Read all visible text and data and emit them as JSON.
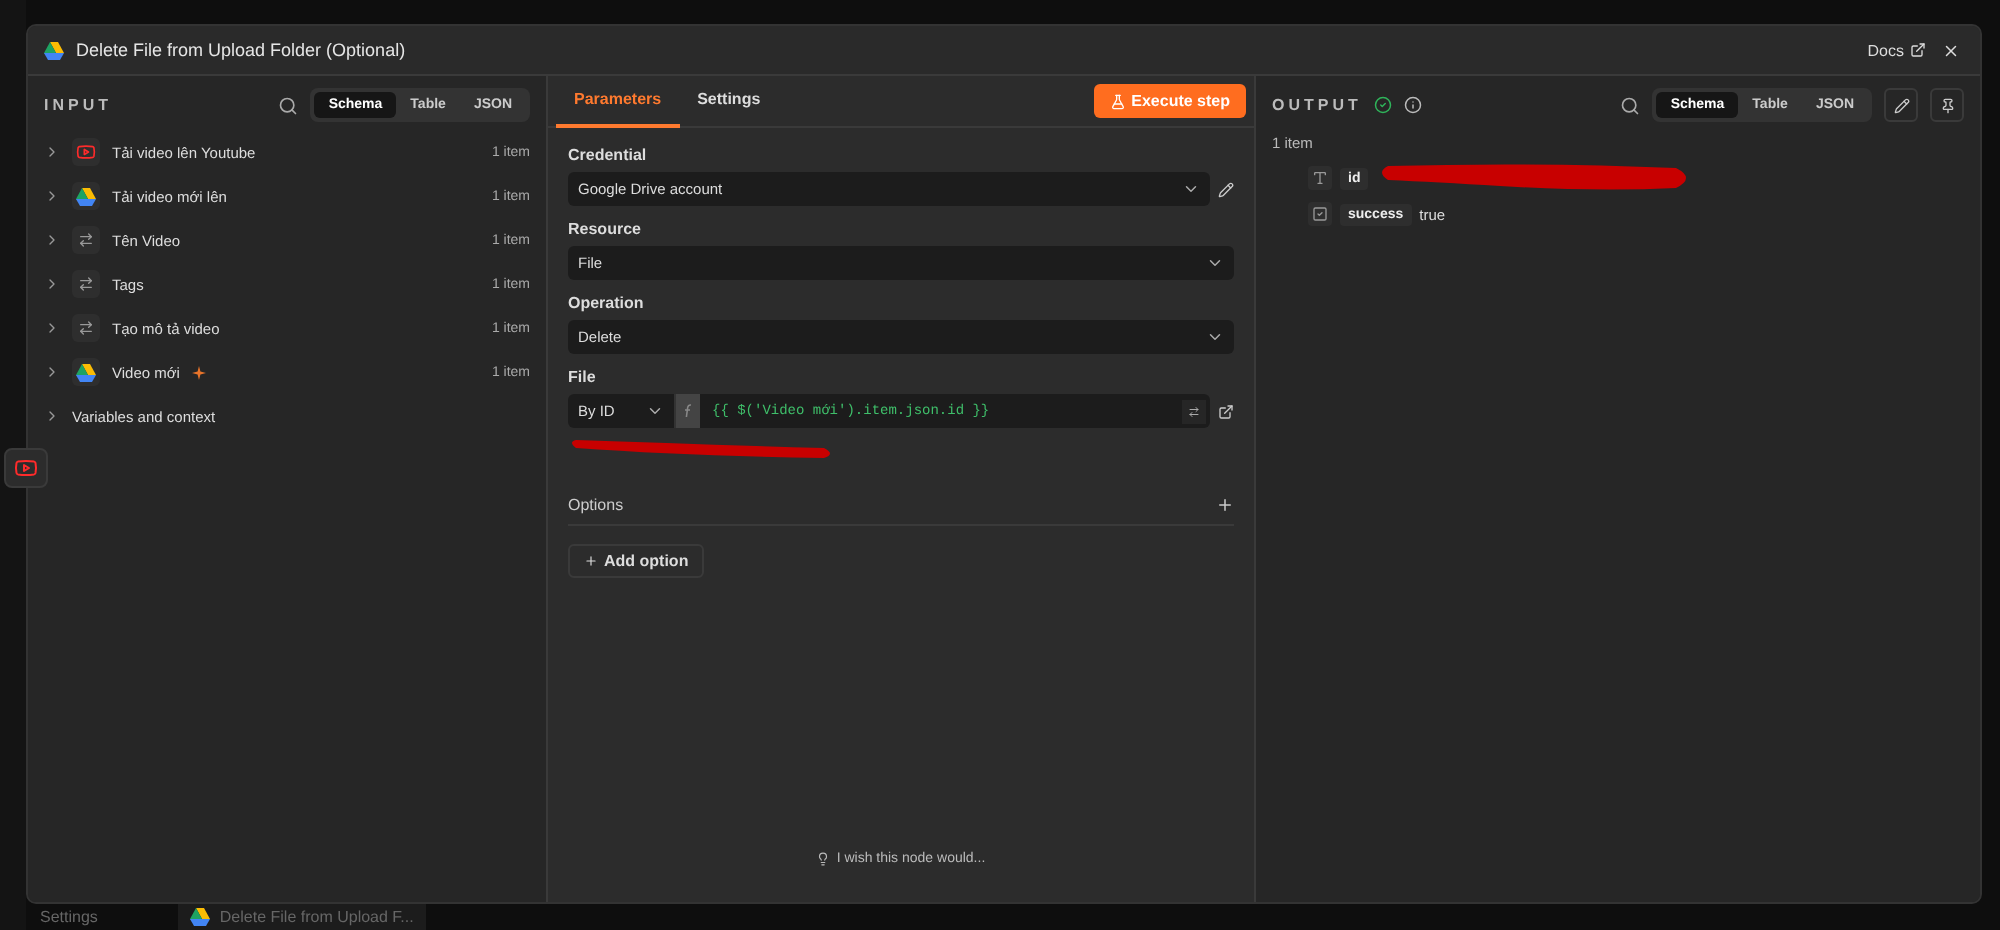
{
  "app": {
    "settings": "Settings",
    "bottom_tab": "Delete File from Upload F..."
  },
  "modal": {
    "title": "Delete File from Upload Folder (Optional)",
    "docs": "Docs"
  },
  "input": {
    "title": "INPUT",
    "view_tabs": [
      {
        "label": "Schema",
        "selected": true
      },
      {
        "label": "Table",
        "selected": false
      },
      {
        "label": "JSON",
        "selected": false
      }
    ],
    "nodes": [
      {
        "name": "Tải video lên Youtube",
        "count": "1 item",
        "kind": "youtube",
        "pinned": false
      },
      {
        "name": "Tải video mới lên",
        "count": "1 item",
        "kind": "drive",
        "pinned": false
      },
      {
        "name": "Tên Video",
        "count": "1 item",
        "kind": "set",
        "pinned": false
      },
      {
        "name": "Tags",
        "count": "1 item",
        "kind": "set",
        "pinned": false
      },
      {
        "name": "Tạo mô tả video",
        "count": "1 item",
        "kind": "set",
        "pinned": false
      },
      {
        "name": "Video mới",
        "count": "1 item",
        "kind": "drive",
        "pinned": true
      }
    ],
    "variables": "Variables and context"
  },
  "parameters": {
    "tabs": [
      {
        "label": "Parameters",
        "selected": true
      },
      {
        "label": "Settings",
        "selected": false
      }
    ],
    "execute": "Execute step",
    "fields": [
      {
        "label": "Credential",
        "value": "Google Drive account",
        "kind": "credential"
      },
      {
        "label": "Resource",
        "value": "File",
        "kind": "select"
      },
      {
        "label": "Operation",
        "value": "Delete",
        "kind": "select"
      }
    ],
    "file": {
      "label": "File",
      "mode": "By ID",
      "expression": "{{ $('Video mới').item.json.id }}"
    },
    "options": "Options",
    "add_option": "Add option",
    "feedback": "I wish this node would..."
  },
  "output": {
    "title": "OUTPUT",
    "succeeded": true,
    "count": "1 item",
    "view_tabs": [
      {
        "label": "Schema",
        "selected": true
      },
      {
        "label": "Table",
        "selected": false
      },
      {
        "label": "JSON",
        "selected": false
      }
    ],
    "fields": [
      {
        "name": "id",
        "kind": "string",
        "redacted": true
      },
      {
        "name": "success",
        "kind": "boolean",
        "value": "true",
        "redacted": false
      }
    ]
  }
}
